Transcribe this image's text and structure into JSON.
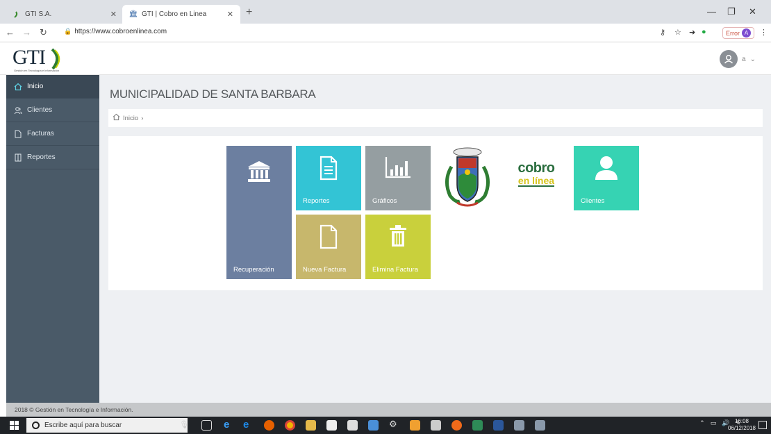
{
  "browser": {
    "tabs": [
      {
        "label": "GTI S.A."
      },
      {
        "label": "GTI | Cobro en Linea"
      }
    ],
    "url": "https://www.cobroenlinea.com",
    "error_label": "Error",
    "profile_initial": "A"
  },
  "app": {
    "logo_text": "GTI",
    "logo_tagline": "Gestión en Tecnología e Información",
    "user_label": "a",
    "page_title": "MUNICIPALIDAD DE SANTA BARBARA",
    "breadcrumb": {
      "home": "Inicio",
      "separator": "›"
    },
    "sidebar": {
      "items": [
        {
          "label": "Inicio",
          "icon": "home-icon"
        },
        {
          "label": "Clientes",
          "icon": "users-icon"
        },
        {
          "label": "Facturas",
          "icon": "document-icon"
        },
        {
          "label": "Reportes",
          "icon": "report-icon"
        }
      ]
    },
    "tiles": {
      "recuperacion": "Recuperación",
      "reportes": "Reportes",
      "graficos": "Gráficos",
      "nueva_factura": "Nueva Factura",
      "elimina_factura": "Elimina Factura",
      "clientes": "Clientes"
    },
    "cobro_logo": {
      "line1": "cobro",
      "line2": "en línea"
    },
    "footer": "2018 © Gestión en Tecnología e Información."
  },
  "taskbar": {
    "search_placeholder": "Escribe aquí para buscar",
    "time": "16:08",
    "date": "06/12/2018"
  },
  "colors": {
    "sidebar": "#4a5a68",
    "recuperacion": "#6c7fa0",
    "reportes": "#33c4d5",
    "graficos": "#959ea1",
    "nueva_factura": "#c7b76c",
    "elimina_factura": "#c9d03c",
    "clientes": "#36d3b3"
  }
}
